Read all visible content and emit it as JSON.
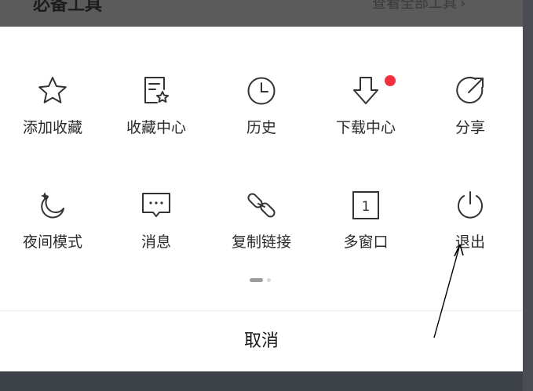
{
  "background": {
    "section_title": "必备工具",
    "view_all_link": "查看全部工具",
    "view_all_chevron": "›"
  },
  "menu": {
    "row1": [
      {
        "label": "添加收藏",
        "icon": "star-icon"
      },
      {
        "label": "收藏中心",
        "icon": "favorites-doc-icon"
      },
      {
        "label": "历史",
        "icon": "clock-icon"
      },
      {
        "label": "下载中心",
        "icon": "download-arrow-icon",
        "badge": "red-dot"
      },
      {
        "label": "分享",
        "icon": "share-arrow-icon"
      }
    ],
    "row2": [
      {
        "label": "夜间模式",
        "icon": "moon-icon"
      },
      {
        "label": "消息",
        "icon": "message-bubble-icon"
      },
      {
        "label": "复制链接",
        "icon": "link-icon"
      },
      {
        "label": "多窗口",
        "icon": "window-count-icon",
        "count": "1"
      },
      {
        "label": "退出",
        "icon": "power-icon"
      }
    ]
  },
  "pagination": {
    "pages": 2,
    "current": 1
  },
  "cancel_label": "取消",
  "colors": {
    "accent_badge": "#f23040",
    "icon_stroke": "#333333",
    "overlay": "#585c61"
  }
}
